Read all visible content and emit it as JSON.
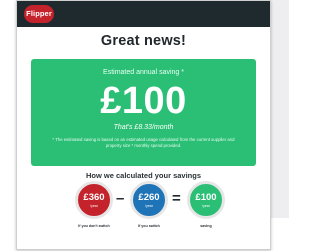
{
  "brand": {
    "logo_text": "Flipper",
    "logo_color": "#c4232b"
  },
  "page": {
    "headline": "Great news!"
  },
  "savings_card": {
    "title": "Estimated annual saving *",
    "amount": "£100",
    "monthly": "That's £8.33/month",
    "disclaimer": "* The estimated saving is based on an estimated usage calculated from the current supplier and property size * monthly spend provided.",
    "background": "#2abf74"
  },
  "calculation": {
    "heading": "How we calculated your savings",
    "operators": [
      "–",
      "="
    ],
    "items": [
      {
        "amount": "£360",
        "sub": "/year",
        "caption": "If you don't switch",
        "color": "#c4232b"
      },
      {
        "amount": "£260",
        "sub": "/year",
        "caption": "If you switch",
        "color": "#1f73b7"
      },
      {
        "amount": "£100",
        "sub": "/year",
        "caption": "saving",
        "color": "#2abf74"
      }
    ]
  }
}
